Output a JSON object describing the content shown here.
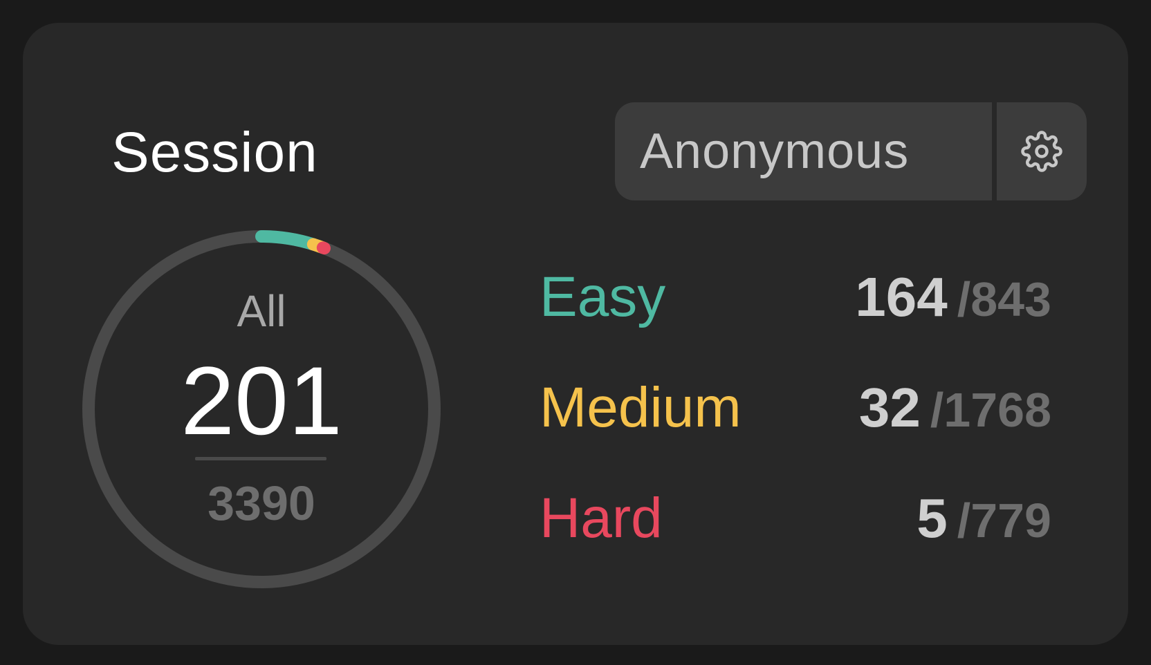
{
  "header": {
    "title": "Session",
    "username": "Anonymous",
    "settings_icon": "gear-icon"
  },
  "summary": {
    "label": "All",
    "solved": "201",
    "total": "3390"
  },
  "stats": [
    {
      "label": "Easy",
      "solved": "164",
      "total": "/843",
      "color": "#4fb9a2",
      "solved_value": 164
    },
    {
      "label": "Medium",
      "solved": "32",
      "total": "/1768",
      "color": "#f5c24c",
      "solved_value": 32
    },
    {
      "label": "Hard",
      "solved": "5",
      "total": "/779",
      "color": "#e8485e",
      "solved_value": 5
    }
  ],
  "colors": {
    "card_bg": "#282828",
    "ring_track": "#4a4a4a"
  }
}
